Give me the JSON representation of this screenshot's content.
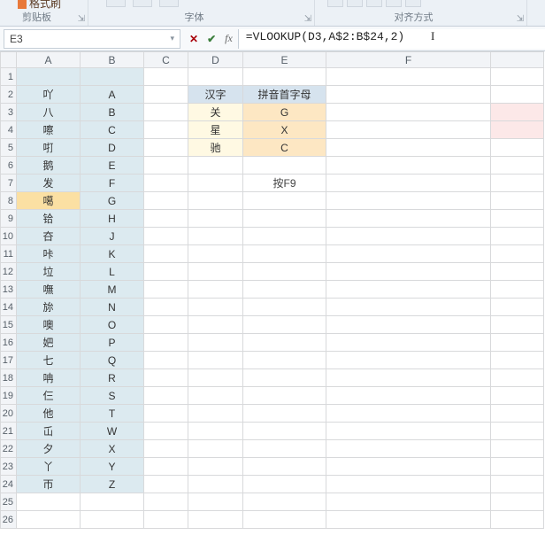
{
  "ribbon": {
    "format_brush_label": "格式刷",
    "clipboard_label": "剪贴板",
    "font_label": "字体",
    "alignment_label": "对齐方式",
    "launcher_glyph": "⇲"
  },
  "namebox": {
    "value": "E3",
    "dropdown_glyph": "▾"
  },
  "formula_bar": {
    "cancel_glyph": "✕",
    "accept_glyph": "✔",
    "fx_label": "fx",
    "formula": "=VLOOKUP(D3,A$2:B$24,2)",
    "cursor": "I"
  },
  "columns": [
    "A",
    "B",
    "C",
    "D",
    "E",
    "F"
  ],
  "row_headers": [
    "1",
    "2",
    "3",
    "4",
    "5",
    "6",
    "7",
    "8",
    "9",
    "10",
    "11",
    "12",
    "13",
    "14",
    "15",
    "16",
    "17",
    "18",
    "19",
    "20",
    "21",
    "22",
    "23",
    "24",
    "25",
    "26"
  ],
  "lookup_table": [
    {
      "a": "吖",
      "b": "A"
    },
    {
      "a": "八",
      "b": "B"
    },
    {
      "a": "嚓",
      "b": "C"
    },
    {
      "a": "咑",
      "b": "D"
    },
    {
      "a": "鹅",
      "b": "E"
    },
    {
      "a": "发",
      "b": "F"
    },
    {
      "a": "噶",
      "b": "G"
    },
    {
      "a": "铪",
      "b": "H"
    },
    {
      "a": "夻",
      "b": "J"
    },
    {
      "a": "咔",
      "b": "K"
    },
    {
      "a": "垃",
      "b": "L"
    },
    {
      "a": "嘸",
      "b": "M"
    },
    {
      "a": "旀",
      "b": "N"
    },
    {
      "a": "噢",
      "b": "O"
    },
    {
      "a": "妑",
      "b": "P"
    },
    {
      "a": "七",
      "b": "Q"
    },
    {
      "a": "呥",
      "b": "R"
    },
    {
      "a": "仨",
      "b": "S"
    },
    {
      "a": "他",
      "b": "T"
    },
    {
      "a": "屲",
      "b": "W"
    },
    {
      "a": "夕",
      "b": "X"
    },
    {
      "a": "丫",
      "b": "Y"
    },
    {
      "a": "帀",
      "b": "Z"
    }
  ],
  "right_block": {
    "header_d": "汉字",
    "header_e": "拼音首字母",
    "rows": [
      {
        "d": "关",
        "e": "G"
      },
      {
        "d": "星",
        "e": "X"
      },
      {
        "d": "驰",
        "e": "C"
      }
    ],
    "f9_text": "按F9"
  }
}
